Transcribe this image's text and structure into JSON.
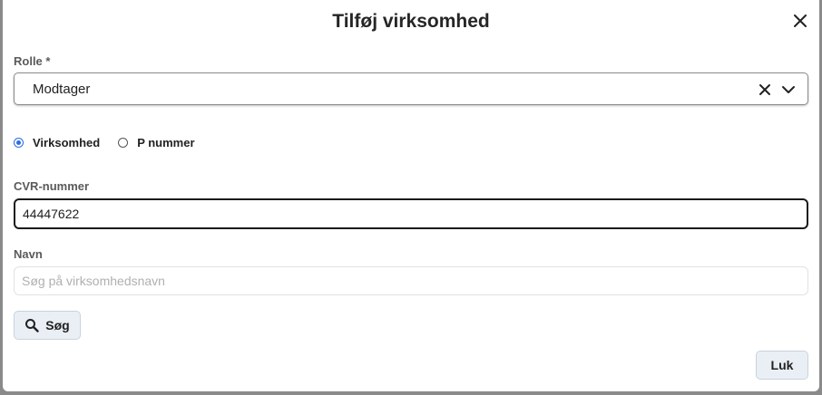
{
  "dialog": {
    "title": "Tilføj virksomhed",
    "close_icon": "close-icon"
  },
  "role": {
    "label": "Rolle *",
    "value": "Modtager",
    "clear_icon": "clear-icon",
    "dropdown_icon": "chevron-down-icon"
  },
  "type_radio": {
    "options": [
      {
        "label": "Virksomhed",
        "checked": true
      },
      {
        "label": "P nummer",
        "checked": false
      }
    ]
  },
  "cvr": {
    "label": "CVR-nummer",
    "value": "44447622"
  },
  "name": {
    "label": "Navn",
    "placeholder": "Søg på virksomhedsnavn",
    "value": ""
  },
  "buttons": {
    "search_label": "Søg",
    "search_icon": "search-icon",
    "close_label": "Luk"
  },
  "colors": {
    "accent": "#2b6de0",
    "button_bg": "#e9eff5"
  }
}
